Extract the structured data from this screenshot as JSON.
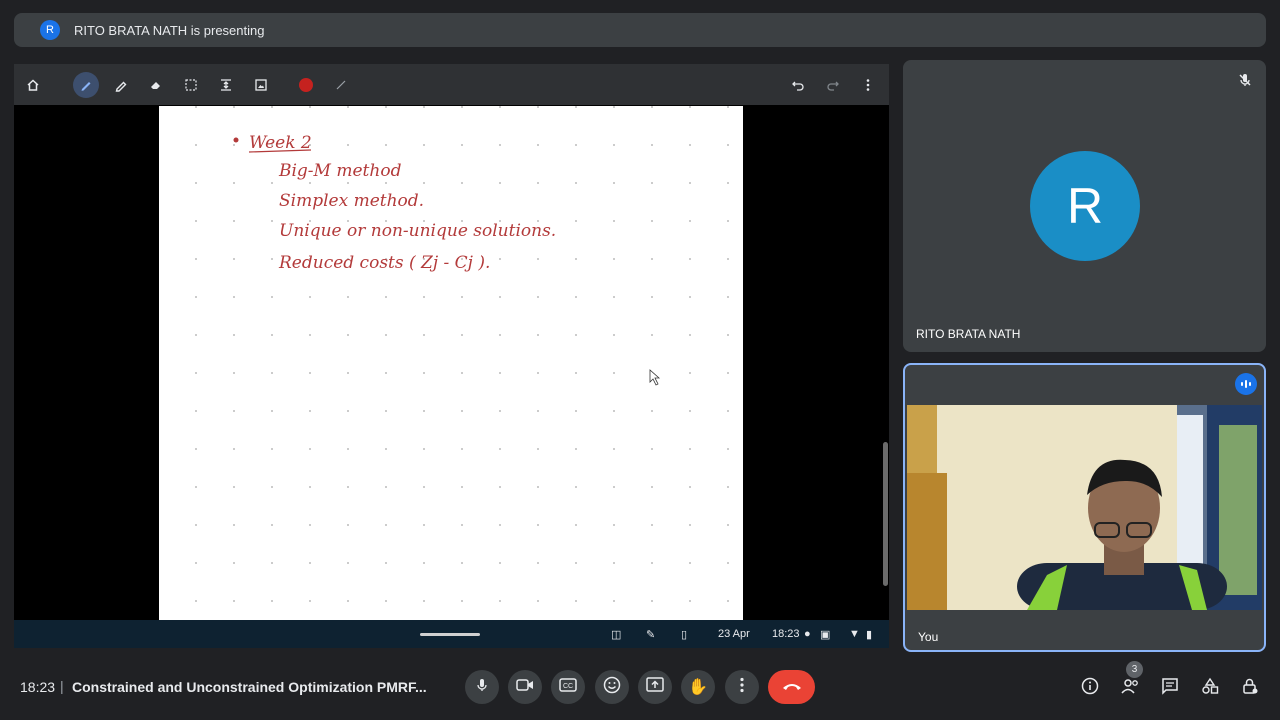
{
  "banner": {
    "avatar_letter": "R",
    "text": "RITO BRATA NATH is presenting"
  },
  "whiteboard": {
    "lines": [
      "Week 2",
      "Big-M method",
      "Simplex method.",
      "Unique or non-unique solutions.",
      "Reduced costs ( Zj - Cj )."
    ],
    "ink_color": "#b33a3a",
    "selected_color": "#c5221f"
  },
  "device_bar": {
    "date": "23 Apr",
    "time": "18:23"
  },
  "participants": [
    {
      "avatar_letter": "R",
      "name": "RITO BRATA NATH",
      "muted": true
    },
    {
      "name": "You",
      "speaking": true
    }
  ],
  "meeting": {
    "time": "18:23",
    "separator": "|",
    "title": "Constrained and Unconstrained Optimization PMRF...",
    "participant_count": "3"
  }
}
